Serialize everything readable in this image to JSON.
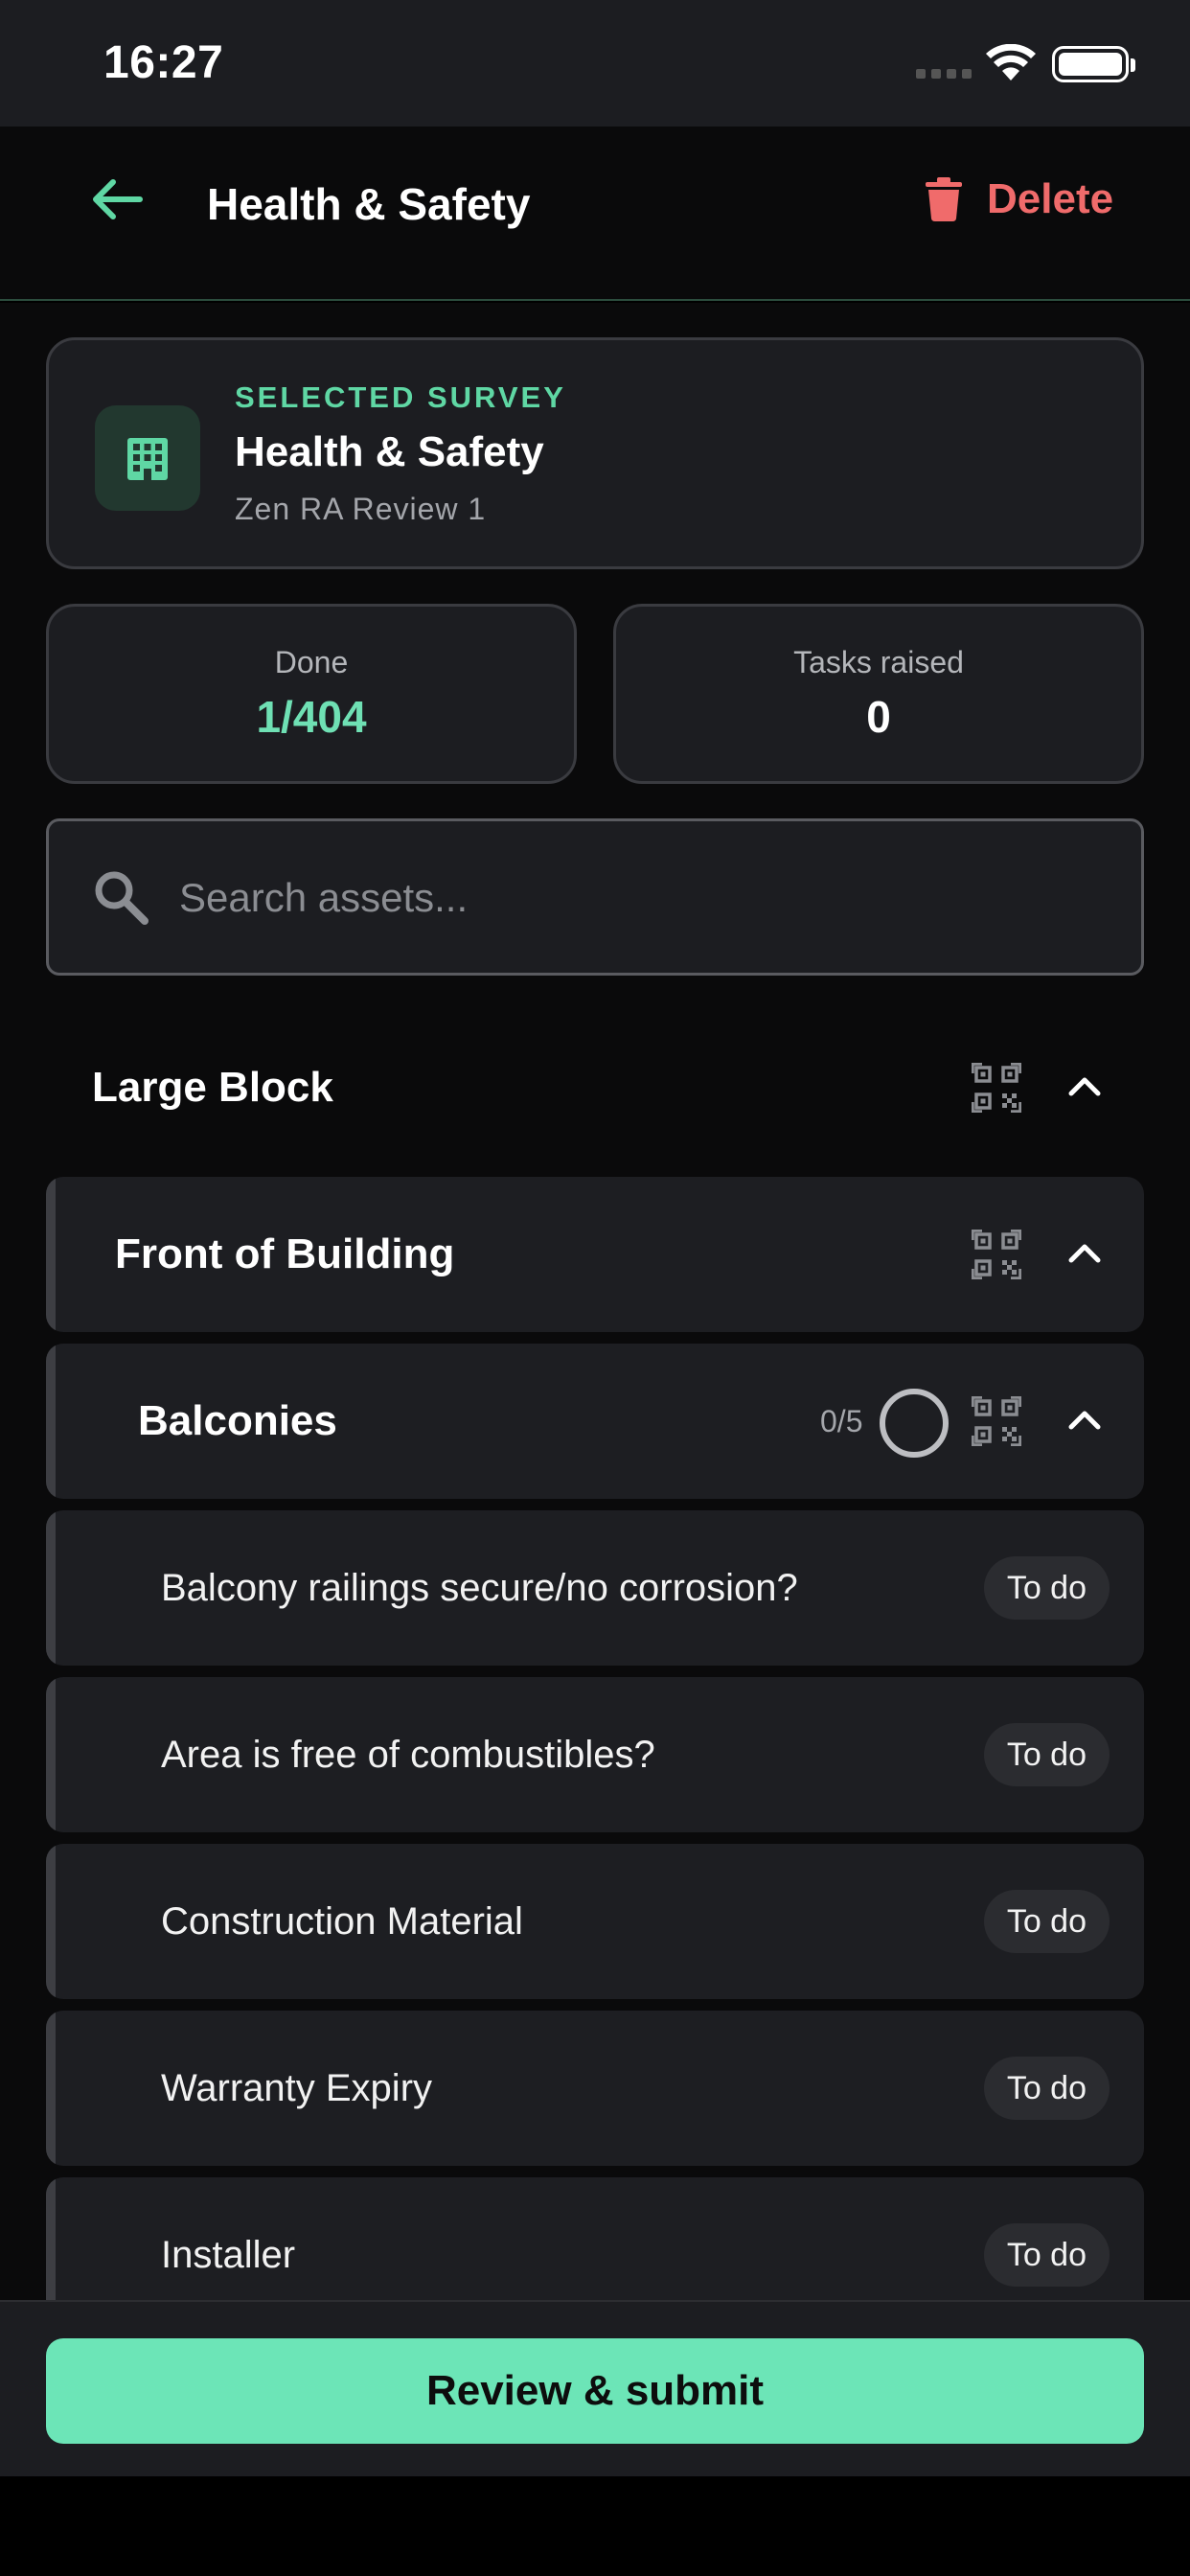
{
  "status_bar": {
    "time": "16:27"
  },
  "header": {
    "title": "Health & Safety",
    "delete_label": "Delete"
  },
  "survey_card": {
    "kicker": "SELECTED SURVEY",
    "name": "Health & Safety",
    "subtitle": "Zen RA Review 1"
  },
  "stats": {
    "done_label": "Done",
    "done_value": "1/404",
    "tasks_label": "Tasks raised",
    "tasks_value": "0"
  },
  "search": {
    "placeholder": "Search assets..."
  },
  "tree": {
    "block": "Large Block",
    "location": "Front of Building",
    "asset": {
      "name": "Balconies",
      "progress": "0/5"
    },
    "items": [
      {
        "label": "Balcony railings secure/no corrosion?",
        "status": "To do"
      },
      {
        "label": "Area is free of combustibles?",
        "status": "To do"
      },
      {
        "label": "Construction Material",
        "status": "To do"
      },
      {
        "label": "Warranty Expiry",
        "status": "To do"
      },
      {
        "label": "Installer",
        "status": "To do"
      }
    ]
  },
  "footer": {
    "submit_label": "Review & submit"
  },
  "colors": {
    "accent": "#6ce5b7",
    "danger": "#f06b6b",
    "surface": "#1c1d21",
    "background": "#0a0a0b"
  }
}
